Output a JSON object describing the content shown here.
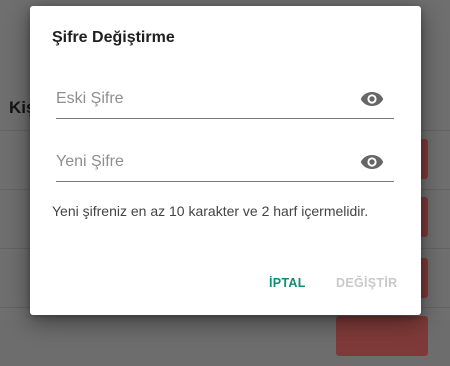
{
  "background": {
    "heading_fragment": "Kişi"
  },
  "dialog": {
    "title": "Şifre Değiştirme",
    "old_password": {
      "placeholder": "Eski Şifre",
      "value": "",
      "toggle_icon": "eye-icon"
    },
    "new_password": {
      "placeholder": "Yeni Şifre",
      "value": "",
      "toggle_icon": "eye-icon"
    },
    "hint": "Yeni şifreniz en az 10 karakter ve 2 harf içermelidir.",
    "actions": {
      "cancel_label": "İPTAL",
      "change_label": "DEĞİŞTİR",
      "change_enabled": false
    }
  },
  "colors": {
    "accent": "#0c8f77",
    "disabled": "#c9c9c9",
    "overlay": "#6f6f6f",
    "background_button": "#7e3a38"
  }
}
